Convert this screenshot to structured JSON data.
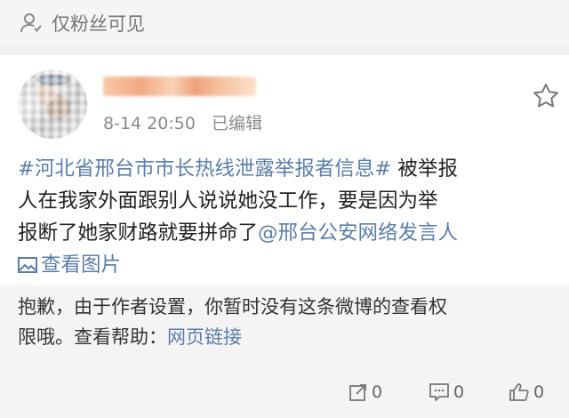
{
  "privacy": {
    "label": "仅粉丝可见"
  },
  "post": {
    "timestamp": "8-14 20:50",
    "edited": "已编辑",
    "topic": "#河北省邢台市市长热线泄露举报者信息#",
    "body_line1": " 被举报",
    "body_line2": "人在我家外面跟别人说说她没工作，要是因为举",
    "body_line3": "报断了她家财路就要拼命了",
    "mention": "@邢台公安网络发言人",
    "view_images": "查看图片"
  },
  "notice": {
    "text_line1": "抱歉，由于作者设置，你暂时没有这条微博的查看权",
    "text_line2": "限哦。查看帮助：",
    "link": "网页链接"
  },
  "actions": {
    "repost_count": "0",
    "comment_count": "0",
    "like_count": "0"
  },
  "colors": {
    "link": "#5b7ea8",
    "notice_bg": "#f4f4f4"
  }
}
